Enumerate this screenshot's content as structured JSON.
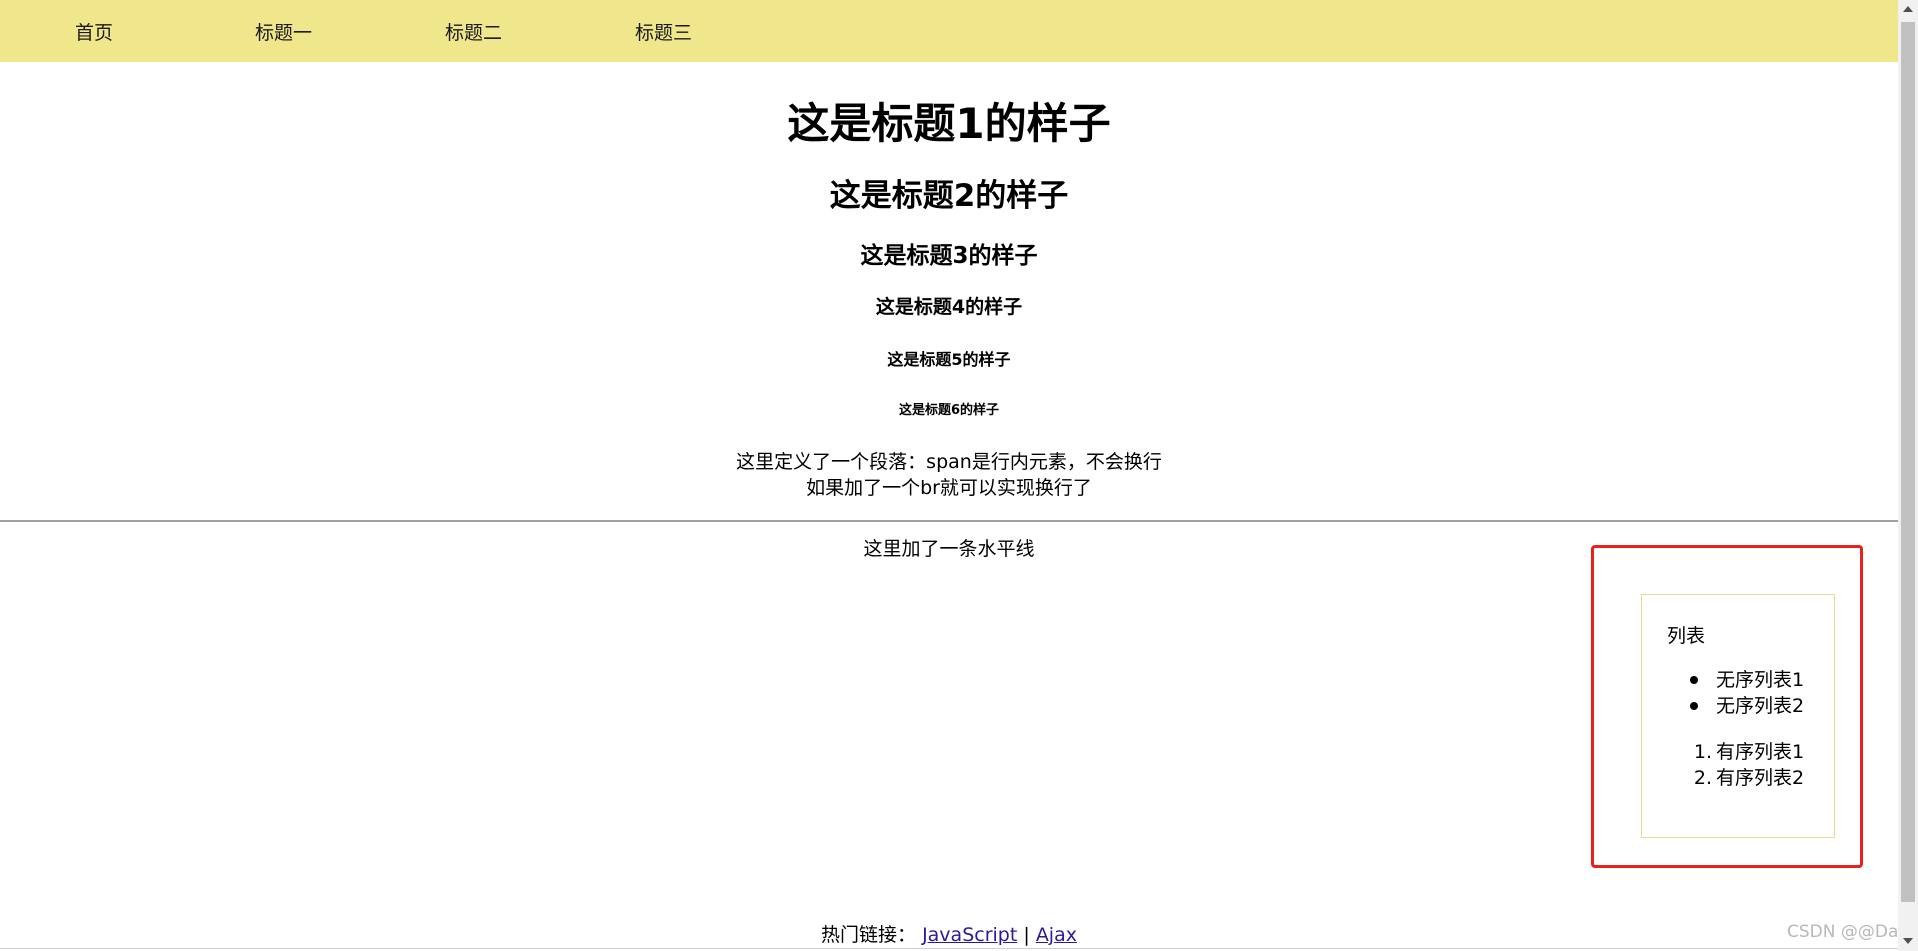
{
  "nav": {
    "items": [
      "首页",
      "标题一",
      "标题二",
      "标题三"
    ]
  },
  "headings": {
    "h1": "这是标题1的样子",
    "h2": "这是标题2的样子",
    "h3": "这是标题3的样子",
    "h4": "这是标题4的样子",
    "h5": "这是标题5的样子",
    "h6": "这是标题6的样子"
  },
  "paragraph": {
    "line1": "这里定义了一个段落：span是行内元素，不会换行",
    "line2": "如果加了一个br就可以实现换行了"
  },
  "hr_caption": "这里加了一条水平线",
  "list_panel": {
    "title": "列表",
    "unordered": [
      "无序列表1",
      "无序列表2"
    ],
    "ordered": [
      "有序列表1",
      "有序列表2"
    ],
    "ordered_markers": [
      "1.",
      "2."
    ]
  },
  "footer": {
    "label": "热门链接：",
    "links": [
      "JavaScript",
      "Ajax"
    ],
    "separator": "|"
  },
  "watermark": "CSDN @@Dai",
  "colors": {
    "nav_bg": "#f0e68c",
    "highlight_border": "#e8211a",
    "link": "#2a1a9c"
  }
}
